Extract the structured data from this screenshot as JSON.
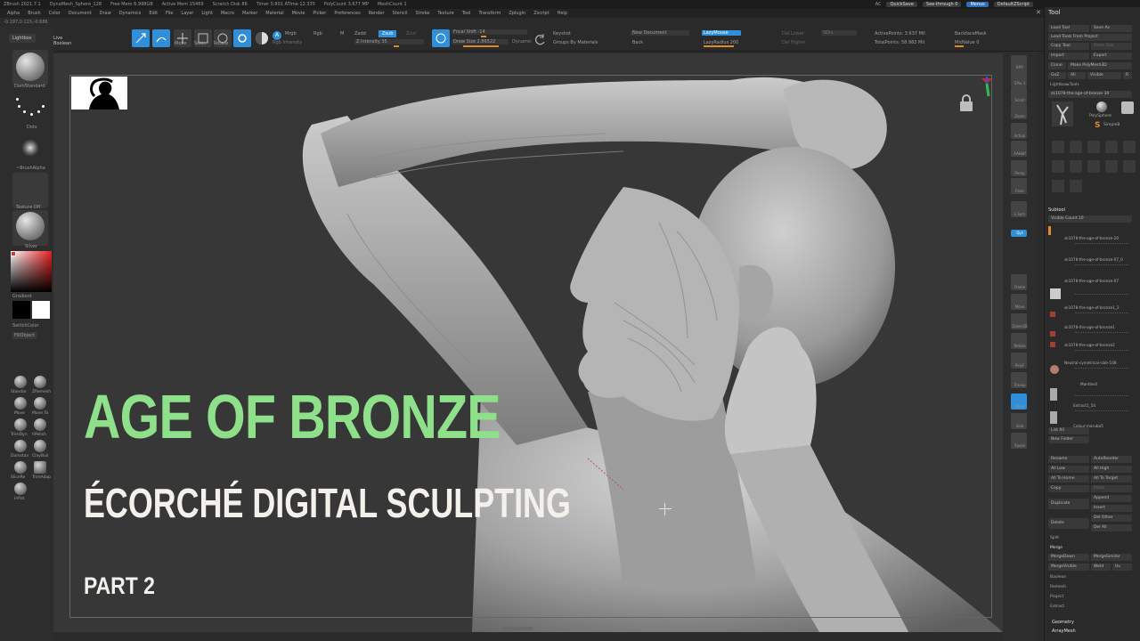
{
  "titlebar": {
    "app": "ZBrush 2021.7.1",
    "file": "DynaMesh_Sphere_128",
    "free_mem": "Free Mem 6.998GB",
    "active_mem": "Active Mem 15469",
    "scratch": "Scratch Disk 86",
    "timer": "Timer 0.801 ATime 12.335",
    "polycount": "PolyCount 3.677 MP",
    "meshcount": "MeshCount 1",
    "ac": "AC",
    "quicksave": "QuickSave",
    "see_through": "See-through 0",
    "menus": "Menus",
    "default_zscript": "DefaultZScript"
  },
  "menubar": [
    "Alpha",
    "Brush",
    "Color",
    "Document",
    "Draw",
    "Dynamics",
    "Edit",
    "File",
    "Layer",
    "Light",
    "Macro",
    "Marker",
    "Material",
    "Movie",
    "Picker",
    "Preferences",
    "Render",
    "Stencil",
    "Stroke",
    "Texture",
    "Tool",
    "Transform",
    "Zplugin",
    "Zscript",
    "Help"
  ],
  "coords": "-0.197,0.115,-0.686",
  "toolbar": {
    "edit": "Edit",
    "draw": "Draw",
    "move": "Move",
    "scale": "Scale",
    "rotate": "Rotate",
    "a_btn": "A",
    "mrgb": "Mrgb",
    "rgb": "Rgb",
    "m": "M",
    "zadd": "Zadd",
    "zsub": "Zsub",
    "zcut": "Zcut",
    "rgb_intensity": "Rgb Intensity",
    "z_intensity": "Z Intensity 35",
    "focal_shift": "Focal Shift -14",
    "draw_size": "Draw Size 2.86522",
    "dynamic": "Dynamic",
    "keyshot": "Keyshot",
    "groups_by_materials": "Groups By Materials",
    "new_document": "New Document",
    "back": "Back",
    "lazy_mouse": "LazyMouse",
    "lazy_radius": "LazyRadius 200",
    "cur_lower": "Del Lower",
    "del_higher": "Del Higher",
    "sdiv": "SDiv",
    "active_points": "ActivePoints: 3.637 Mil",
    "total_points": "TotalPoints: 58.982 Mil",
    "backface_mask": "BackfaceMask",
    "mid_value": "MidValue 0"
  },
  "leftshelf": {
    "lightbox": "Lightbox",
    "live_boolean": "Live Boolean",
    "brush_name": "DamStandard",
    "stroke_name": "Dots",
    "alpha_name": "~BrushAlpha",
    "texture_name": "Texture Off",
    "material_name": "Silver",
    "gradient": "Gradient",
    "switch_color": "SwitchColor",
    "fill_object": "FillObject",
    "quick_brushes": [
      "Standar",
      "ZRemesh",
      "Move",
      "Move To",
      "TrimDyn",
      "hPolish",
      "Damstan",
      "ClayBuil",
      "SliceRe",
      "TrimAdap",
      "Inflat"
    ]
  },
  "viewport": {
    "headline": "AGE OF BRONZE",
    "subtitle": "ÉCORCHÉ DIGITAL SCULPTING",
    "part": "PART 2",
    "headline_color": "#8fe08a",
    "subtitle_color": "#f4f0ec"
  },
  "rightshelf": [
    "BPR",
    "SPix 3",
    "Scroll",
    "Zoom",
    "Actual",
    "AAHalf",
    "Persp",
    "Floor",
    "L.Sym",
    "Qyz",
    "Frame",
    "Move",
    "Zoom3D",
    "Rotate",
    "PolyF",
    "Transp",
    "Dyna",
    "Solo",
    "Xpose"
  ],
  "toolpanel": {
    "title": "Tool",
    "load_tool": "Load Tool",
    "save_as": "Save As",
    "load_from_project": "Load Tools From Project",
    "copy_tool": "Copy Tool",
    "paste_tool": "Paste Tool",
    "import": "Import",
    "export": "Export",
    "clone": "Clone",
    "make_polymesh": "Make PolyMesh3D",
    "goz": "GoZ",
    "all": "All",
    "visible": "Visible",
    "r": "R",
    "lightbox_tools": "Lightbox▸Tools",
    "current_tool": "sk1078-the-age-of-bronze 30",
    "polysphere": "PolySphere",
    "simplebrush": "SimpleB",
    "subtool_header": "Subtool",
    "visible_count": "Visible Count 10",
    "subtools": [
      "sk1078-the-age-of-bronze-20",
      "sk1078-the-age-of-bronze-07_0",
      "sk1078-the-age-of-bronze-07",
      "sk1078-the-age-of-bronze1_2",
      "sk1078-the-age-of-bronze1",
      "sk1078-the-age-of-bronze2",
      "Neutral-cymetrical-slah-108",
      "Mantles4",
      "Extract1_54",
      "Colour-maruba5"
    ],
    "list_all": "List All",
    "new_folder": "New Folder",
    "rename": "Rename",
    "auto_reorder": "AutoReorder",
    "all_low": "All Low",
    "all_high": "All High",
    "all_to_home": "All To Home",
    "all_to_target": "All To Target",
    "copy": "Copy",
    "paste": "Paste",
    "duplicate": "Duplicate",
    "append": "Append",
    "insert": "Insert",
    "delete": "Delete",
    "del_other": "Del Other",
    "del_all": "Del All",
    "split": "Split",
    "merge": "Merge",
    "merge_down": "MergeDown",
    "merge_similar": "MergeSimilar",
    "merge_visible": "MergeVisible",
    "weld": "Weld",
    "uv": "Uv",
    "boolean": "Boolean",
    "remesh": "Remesh",
    "project": "Project",
    "extract": "Extract",
    "geometry": "Geometry",
    "arraymesh": "ArrayMesh"
  },
  "colors": {
    "accent": "#2f8fd8",
    "orange": "#e08a2c",
    "headline": "#8fe08a"
  }
}
